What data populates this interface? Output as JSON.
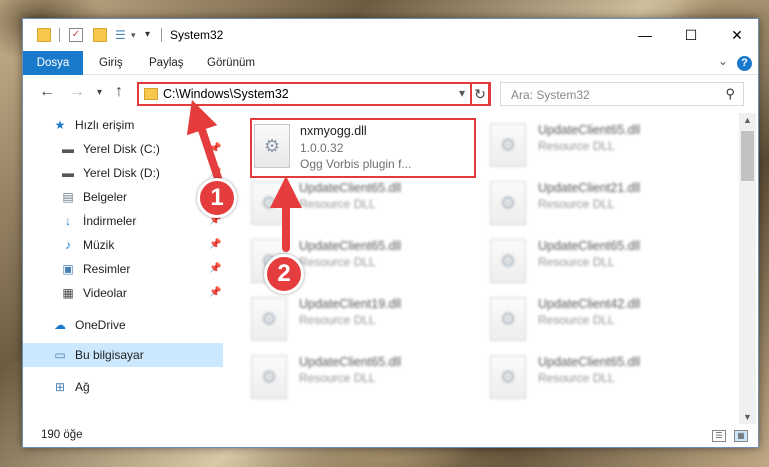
{
  "window": {
    "title": "System32",
    "dropdown_glyph": "▾"
  },
  "ribbon": {
    "tabs": [
      "Dosya",
      "Giriş",
      "Paylaş",
      "Görünüm"
    ],
    "help": "?"
  },
  "navigation": {
    "address": "C:\\Windows\\System32",
    "search_placeholder": "Ara: System32"
  },
  "sidebar": {
    "items": [
      {
        "label": "Hızlı erişim",
        "icon": "star-icon",
        "glyph": "★",
        "color": "#1979ca"
      },
      {
        "label": "Yerel Disk (C:)",
        "icon": "drive-icon",
        "glyph": "▬",
        "color": "#555",
        "pin": true
      },
      {
        "label": "Yerel Disk (D:)",
        "icon": "drive-icon",
        "glyph": "▬",
        "color": "#555",
        "pin": true
      },
      {
        "label": "Belgeler",
        "icon": "documents-icon",
        "glyph": "▤",
        "color": "#6a7a8a",
        "pin": true
      },
      {
        "label": "İndirmeler",
        "icon": "download-icon",
        "glyph": "↓",
        "color": "#1979ca",
        "pin": true
      },
      {
        "label": "Müzik",
        "icon": "music-icon",
        "glyph": "♪",
        "color": "#1979ca",
        "pin": true
      },
      {
        "label": "Resimler",
        "icon": "pictures-icon",
        "glyph": "▣",
        "color": "#4a7fb5",
        "pin": true
      },
      {
        "label": "Videolar",
        "icon": "video-icon",
        "glyph": "▦",
        "color": "#444",
        "pin": true
      },
      {
        "label": "OneDrive",
        "icon": "cloud-icon",
        "glyph": "☁",
        "color": "#1979ca"
      },
      {
        "label": "Bu bilgisayar",
        "icon": "computer-icon",
        "glyph": "▭",
        "color": "#4a7fb5",
        "selected": true
      },
      {
        "label": "Ağ",
        "icon": "network-icon",
        "glyph": "⊞",
        "color": "#4a7fb5"
      }
    ]
  },
  "files": {
    "highlighted": {
      "name": "nxmyogg.dll",
      "version": "1.0.0.32",
      "description": "Ogg Vorbis plugin f..."
    },
    "left_column": [
      {
        "name": "UpdateClient65.dll",
        "type": "Resource DLL"
      },
      {
        "name": "UpdateClient65.dll",
        "type": "Resource DLL"
      },
      {
        "name": "UpdateClient19.dll",
        "type": "Resource DLL"
      },
      {
        "name": "UpdateClient65.dll",
        "type": "Resource DLL"
      }
    ],
    "right_column": [
      {
        "name": "UpdateClient65.dll",
        "type": "Resource DLL"
      },
      {
        "name": "UpdateClient21.dll",
        "type": "Resource DLL"
      },
      {
        "name": "UpdateClient65.dll",
        "type": "Resource DLL"
      },
      {
        "name": "UpdateClient42.dll",
        "type": "Resource DLL"
      },
      {
        "name": "UpdateClient65.dll",
        "type": "Resource DLL"
      }
    ]
  },
  "status": {
    "count": "190 öğe"
  },
  "annotations": {
    "step1": "1",
    "step2": "2",
    "color": "#e53d3d"
  }
}
